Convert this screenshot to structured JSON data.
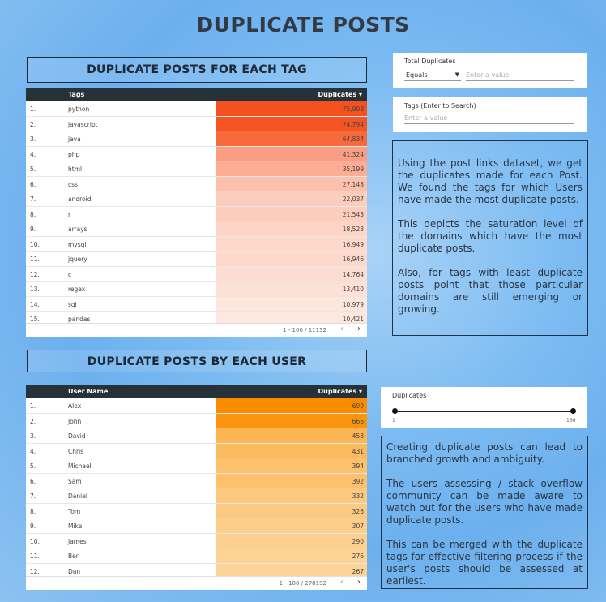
{
  "page_title": "DUPLICATE POSTS",
  "tags_section": {
    "title": "DUPLICATE POSTS FOR EACH TAG",
    "col_name": "Tags",
    "col_value": "Duplicates ▾",
    "rows": [
      {
        "idx": "1.",
        "name": "python",
        "value": "75,908",
        "color": "#f4511e"
      },
      {
        "idx": "2.",
        "name": "javascript",
        "value": "74,794",
        "color": "#f55522"
      },
      {
        "idx": "3.",
        "name": "java",
        "value": "64,834",
        "color": "#f66a3c"
      },
      {
        "idx": "4.",
        "name": "php",
        "value": "41,324",
        "color": "#f99e82"
      },
      {
        "idx": "5.",
        "name": "html",
        "value": "35,199",
        "color": "#fbad95"
      },
      {
        "idx": "6.",
        "name": "css",
        "value": "27,148",
        "color": "#fcc0ad"
      },
      {
        "idx": "7.",
        "name": "android",
        "value": "22,037",
        "color": "#fcccbc"
      },
      {
        "idx": "8.",
        "name": "r",
        "value": "21,543",
        "color": "#fccdbd"
      },
      {
        "idx": "9.",
        "name": "arrays",
        "value": "18,523",
        "color": "#fdd4c6"
      },
      {
        "idx": "10.",
        "name": "mysql",
        "value": "16,949",
        "color": "#fdd8cb"
      },
      {
        "idx": "11.",
        "name": "jquery",
        "value": "16,946",
        "color": "#fdd8cb"
      },
      {
        "idx": "12.",
        "name": "c",
        "value": "14,764",
        "color": "#fddcd1"
      },
      {
        "idx": "13.",
        "name": "regex",
        "value": "13,410",
        "color": "#fde0d6"
      },
      {
        "idx": "14.",
        "name": "sql",
        "value": "10,979",
        "color": "#fee6dd"
      },
      {
        "idx": "15.",
        "name": "pandas",
        "value": "10,421",
        "color": "#fee7df"
      }
    ],
    "pager_range": "1 - 100 / 11132"
  },
  "users_section": {
    "title": "DUPLICATE POSTS BY EACH USER",
    "col_name": "User Name",
    "col_value": "Duplicates ▾",
    "rows": [
      {
        "idx": "1.",
        "name": "Alex",
        "value": "699",
        "color": "#fb8c00"
      },
      {
        "idx": "2.",
        "name": "John",
        "value": "666",
        "color": "#fb950f"
      },
      {
        "idx": "3.",
        "name": "David",
        "value": "458",
        "color": "#fcb553"
      },
      {
        "idx": "4.",
        "name": "Chris",
        "value": "431",
        "color": "#fcba5e"
      },
      {
        "idx": "5.",
        "name": "Michael",
        "value": "394",
        "color": "#fdc06b"
      },
      {
        "idx": "6.",
        "name": "Sam",
        "value": "392",
        "color": "#fdc06c"
      },
      {
        "idx": "7.",
        "name": "Daniel",
        "value": "332",
        "color": "#fdc981"
      },
      {
        "idx": "8.",
        "name": "Tom",
        "value": "326",
        "color": "#fdca83"
      },
      {
        "idx": "9.",
        "name": "Mike",
        "value": "307",
        "color": "#fdcd8a"
      },
      {
        "idx": "10.",
        "name": "James",
        "value": "290",
        "color": "#fdd090"
      },
      {
        "idx": "11.",
        "name": "Ben",
        "value": "276",
        "color": "#fdd295"
      },
      {
        "idx": "12.",
        "name": "Dan",
        "value": "267",
        "color": "#fdd498"
      }
    ],
    "pager_range": "1 - 100 / 278192"
  },
  "filter_total": {
    "label": "Total Duplicates",
    "operator": "Equals",
    "placeholder": "Enter a value"
  },
  "filter_tags": {
    "label": "Tags (Enter to Search)",
    "placeholder": "Enter a value"
  },
  "note_tags": {
    "p1": "Using the post links dataset, we get the duplicates made for each Post. We found the tags for which Users have made the most duplicate posts.",
    "p2": "This depicts the saturation level of the domains which have the most duplicate posts.",
    "p3": "Also, for tags with least duplicate posts point that those particular domains are still emerging or growing."
  },
  "slider": {
    "label": "Duplicates",
    "min": "1",
    "max": "166"
  },
  "note_users": {
    "p1": "Creating duplicate posts can lead to branched growth and ambiguity.",
    "p2": "The users assessing / stack overflow community can be made aware to watch out for the users who have made duplicate posts.",
    "p3": "This can be merged with the duplicate tags for effective filtering process if the user's posts should be assessed at earliest."
  },
  "pager_icons": {
    "prev": "chevron-left-icon",
    "next": "chevron-right-icon"
  }
}
